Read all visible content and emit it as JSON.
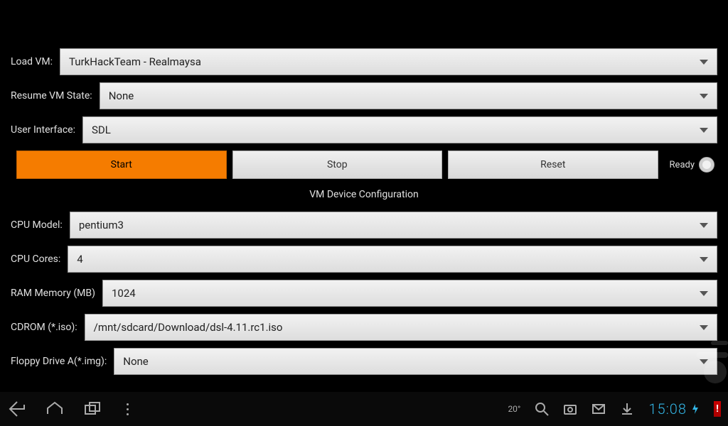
{
  "form": {
    "loadVm": {
      "label": "Load VM:",
      "value": "TurkHackTeam - Realmaysa"
    },
    "resumeState": {
      "label": "Resume VM State:",
      "value": "None"
    },
    "userInterface": {
      "label": "User Interface:",
      "value": "SDL"
    },
    "cpuModel": {
      "label": "CPU Model:",
      "value": "pentium3"
    },
    "cpuCores": {
      "label": "CPU Cores:",
      "value": "4"
    },
    "ram": {
      "label": "RAM Memory (MB)",
      "value": "1024"
    },
    "cdrom": {
      "label": "CDROM (*.iso):",
      "value": "/mnt/sdcard/Download/dsl-4.11.rc1.iso"
    },
    "floppyA": {
      "label": "Floppy Drive A(*.img):",
      "value": "None"
    }
  },
  "buttons": {
    "start": "Start",
    "stop": "Stop",
    "reset": "Reset",
    "ready": "Ready"
  },
  "sectionTitle": "VM Device Configuration",
  "statusbar": {
    "temp": "20°",
    "time": "15:08"
  }
}
